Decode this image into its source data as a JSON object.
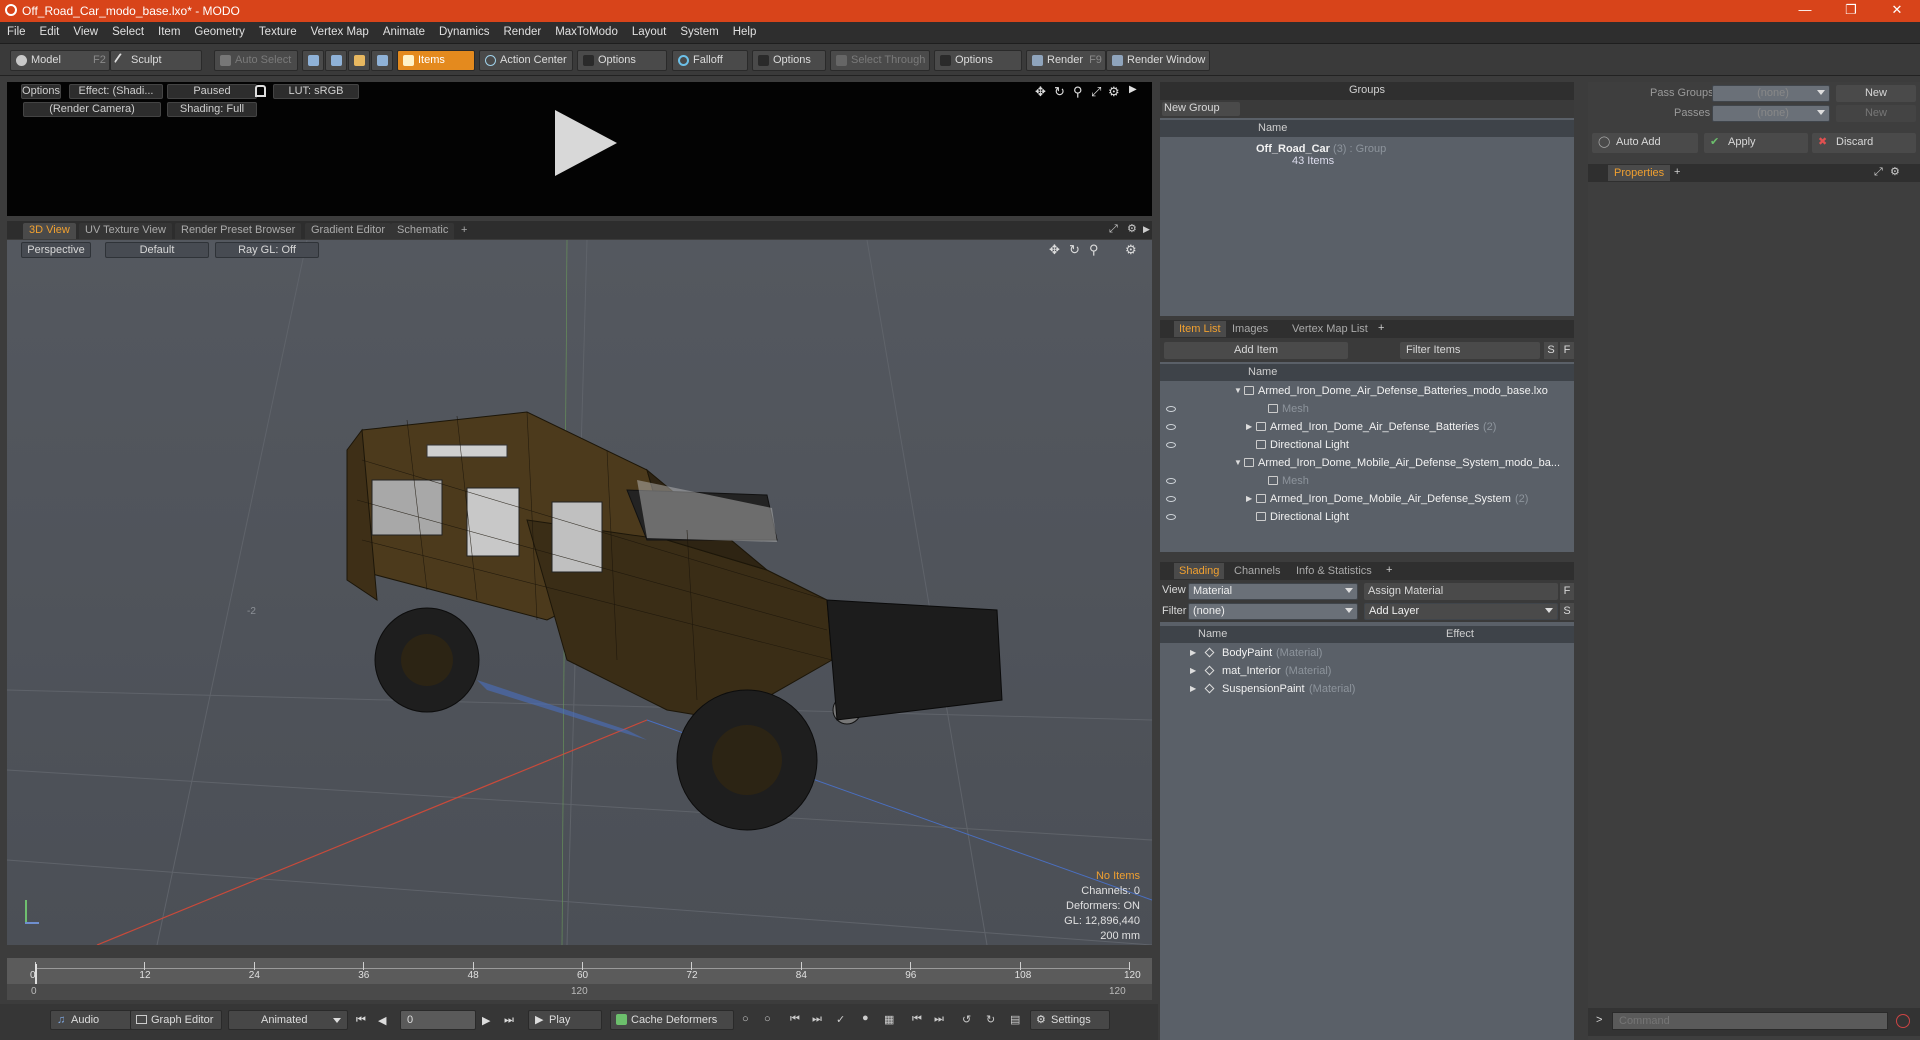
{
  "window": {
    "title": "Off_Road_Car_modo_base.lxo* - MODO"
  },
  "menu": [
    "File",
    "Edit",
    "View",
    "Select",
    "Item",
    "Geometry",
    "Texture",
    "Vertex Map",
    "Animate",
    "Dynamics",
    "Render",
    "MaxToModo",
    "Layout",
    "System",
    "Help"
  ],
  "toolbar": {
    "model": "Model",
    "model_key": "F2",
    "sculpt": "Sculpt",
    "auto_select": "Auto Select",
    "items": "Items",
    "action_center": "Action Center",
    "options1": "Options",
    "falloff": "Falloff",
    "options2": "Options",
    "select_through": "Select Through",
    "options3": "Options",
    "render": "Render",
    "render_key": "F9",
    "render_window": "Render Window"
  },
  "render_preview": {
    "options": "Options",
    "effect": "Effect: (Shadi...",
    "status": "Paused",
    "lut": "LUT: sRGB",
    "camera": "(Render Camera)",
    "shading": "Shading: Full"
  },
  "viewport_tabs": [
    "3D View",
    "UV Texture View",
    "Render Preset Browser",
    "Gradient Editor",
    "Schematic",
    "+"
  ],
  "viewport": {
    "projection": "Perspective",
    "style": "Default",
    "raygl": "Ray GL: Off",
    "axis_label": "-2",
    "stats": {
      "items": "No Items",
      "channels": "Channels: 0",
      "deformers": "Deformers: ON",
      "gl": "GL: 12,896,440",
      "scale": "200 mm"
    }
  },
  "timeline": {
    "ticks": [
      "0",
      "12",
      "24",
      "36",
      "48",
      "60",
      "72",
      "84",
      "96",
      "108",
      "120"
    ],
    "sub_ticks": [
      "0",
      "120",
      "120"
    ]
  },
  "bottombar": {
    "audio": "Audio",
    "graph_editor": "Graph Editor",
    "animated": "Animated",
    "frame": "0",
    "play": "Play",
    "cache_deformers": "Cache Deformers",
    "settings": "Settings"
  },
  "groups": {
    "title": "Groups",
    "new_group": "New Group",
    "name_col": "Name",
    "item_name": "Off_Road_Car",
    "item_count": "(3)",
    "item_type": ": Group",
    "item_sub": "43 Items"
  },
  "pass_groups": {
    "pass_groups_label": "Pass Groups",
    "pass_groups_value": "(none)",
    "new1": "New",
    "passes_label": "Passes",
    "passes_value": "(none)",
    "new2": "New",
    "auto_add": "Auto Add",
    "apply": "Apply",
    "discard": "Discard",
    "properties_tab": "Properties",
    "plus": "+"
  },
  "itemlist": {
    "tabs": [
      "Item List",
      "Images",
      "Vertex Map List",
      "+"
    ],
    "add_item": "Add Item",
    "filter": "Filter Items",
    "s": "S",
    "f": "F",
    "name_col": "Name",
    "rows": [
      {
        "label": "Armed_Iron_Dome_Air_Defense_Batteries_modo_base.lxo",
        "indent": 0,
        "expander": "▼",
        "grey": false,
        "eye": false
      },
      {
        "label": "Mesh",
        "indent": 2,
        "expander": "",
        "grey": true,
        "eye": true
      },
      {
        "label": "Armed_Iron_Dome_Air_Defense_Batteries",
        "suffix": "(2)",
        "indent": 1,
        "expander": "▶",
        "grey": false,
        "eye": true
      },
      {
        "label": "Directional Light",
        "indent": 1,
        "expander": "",
        "grey": false,
        "eye": true
      },
      {
        "label": "Armed_Iron_Dome_Mobile_Air_Defense_System_modo_ba...",
        "indent": 0,
        "expander": "▼",
        "grey": false,
        "eye": false
      },
      {
        "label": "Mesh",
        "indent": 2,
        "expander": "",
        "grey": true,
        "eye": true
      },
      {
        "label": "Armed_Iron_Dome_Mobile_Air_Defense_System",
        "suffix": "(2)",
        "indent": 1,
        "expander": "▶",
        "grey": false,
        "eye": true
      },
      {
        "label": "Directional Light",
        "indent": 1,
        "expander": "",
        "grey": false,
        "eye": true
      }
    ]
  },
  "shading": {
    "tabs": [
      "Shading",
      "Channels",
      "Info & Statistics",
      "+"
    ],
    "view_label": "View",
    "view_value": "Material",
    "assign": "Assign Material",
    "f": "F",
    "filter_label": "Filter",
    "filter_value": "(none)",
    "add_layer": "Add Layer",
    "s": "S",
    "name_col": "Name",
    "effect_col": "Effect",
    "rows": [
      {
        "label": "BodyPaint",
        "type": "(Material)"
      },
      {
        "label": "mat_Interior",
        "type": "(Material)"
      },
      {
        "label": "SuspensionPaint",
        "type": "(Material)"
      }
    ]
  },
  "command": {
    "placeholder": "Command",
    "prompt": ">"
  },
  "colors": {
    "accent": "#e48a1e",
    "title_bar": "#d8441a",
    "panel": "#5a6068",
    "viewport": "#50545b"
  }
}
